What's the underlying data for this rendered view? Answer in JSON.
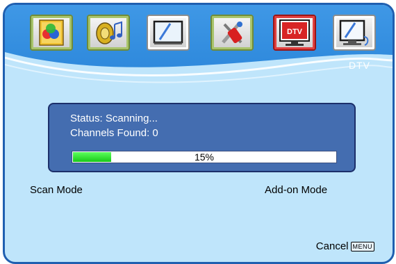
{
  "toolbar": {
    "icons": [
      {
        "name": "picture-icon",
        "label": ""
      },
      {
        "name": "sound-icon",
        "label": ""
      },
      {
        "name": "screen-icon",
        "label": ""
      },
      {
        "name": "setup-tools-icon",
        "label": ""
      },
      {
        "name": "dtv-icon",
        "label": "DTV"
      },
      {
        "name": "pc-input-icon",
        "label": ""
      }
    ],
    "selected_index": 4
  },
  "menu_title": "DTV",
  "status": {
    "status_line": "Status: Scanning...",
    "channels_line": "Channels Found: 0",
    "progress_percent": 15,
    "progress_text": "15%"
  },
  "modes": {
    "scan_mode": "Scan Mode",
    "addon_mode": "Add-on Mode"
  },
  "footer": {
    "cancel_label": "Cancel",
    "menu_key_label": "MENU"
  },
  "colors": {
    "frame_border": "#1f5fb0",
    "header_blue": "#2b86da",
    "body_bg": "#bfe5fb",
    "panel_bg": "#446db0",
    "progress_green": "#18c818",
    "selected_border": "#9a1414"
  }
}
